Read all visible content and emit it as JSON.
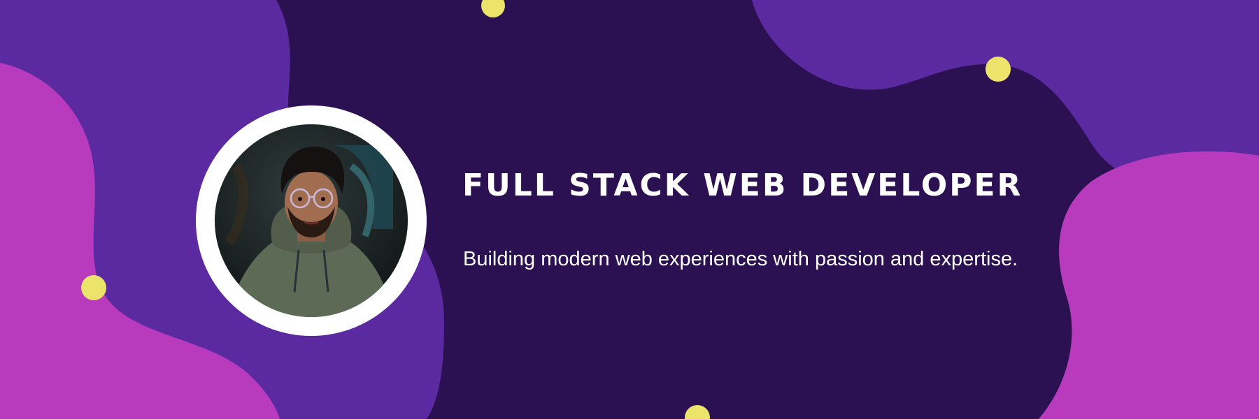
{
  "hero": {
    "title": "FULL STACK WEB DEVELOPER",
    "subtitle": "Building modern web experiences with passion and expertise.",
    "avatar_icon": "developer-portrait"
  },
  "colors": {
    "background": "#2c1152",
    "blob_violet": "#5b2aa1",
    "blob_magenta": "#b93bbd",
    "dot_yellow": "#ece46a",
    "ring": "#ffffff",
    "text": "#ffffff"
  }
}
